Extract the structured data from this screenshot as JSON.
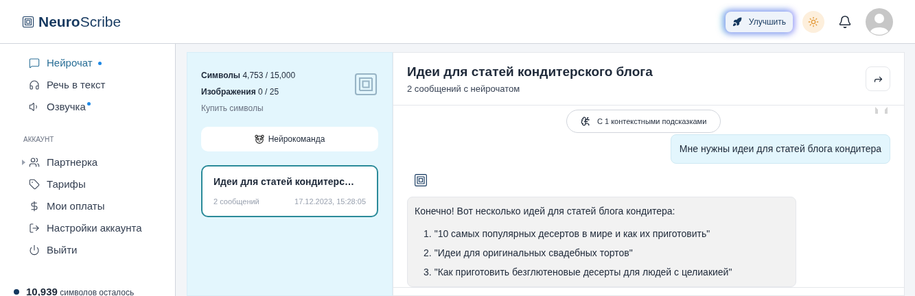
{
  "header": {
    "logo_bold": "Neuro",
    "logo_light": "Scribe",
    "upgrade_button": "Улучшить"
  },
  "sidebar": {
    "items": [
      {
        "label": "Нейрочат",
        "selected": true,
        "dot": true
      },
      {
        "label": "Речь в текст",
        "selected": false,
        "dot": false
      },
      {
        "label": "Озвучка",
        "selected": false,
        "dot": true
      }
    ],
    "section_title": "АККАУНТ",
    "account_items": [
      {
        "label": "Партнерка",
        "selected": false,
        "expanded": false
      },
      {
        "label": "Тарифы",
        "selected": false
      },
      {
        "label": "Мои оплаты",
        "selected": false
      },
      {
        "label": "Настройки аккаунта",
        "selected": false
      },
      {
        "label": "Выйти",
        "selected": false
      }
    ],
    "balance": {
      "value": "10,939",
      "label": "символов осталось"
    }
  },
  "usage": {
    "symbols_label": "Символы",
    "symbols": "4,753 / 15,000",
    "images_label": "Изображения",
    "images": "0 / 25",
    "buy_link": "Купить символы"
  },
  "team_button": "Нейрокоманда",
  "chats": [
    {
      "title": "Идеи для статей кондитерс…",
      "count": "2 сообщений",
      "date": "17.12.2023, 15:28:05",
      "selected": true
    }
  ],
  "chat": {
    "title": "Идеи для статей кондитерского блога",
    "subtitle": "2 сообщений с нейрочатом",
    "context_pill": "С 1 контекстными подсказками",
    "user_message": "Мне нужны идеи для статей блога кондитера",
    "reply_intro": "Конечно! Вот несколько идей для статей блога кондитера:",
    "reply_items": [
      {
        "number": "1.",
        "text": "\"10 самых популярных десертов в мире и как их приготовить\""
      },
      {
        "number": "2.",
        "text": "\"Идеи для оригинальных свадебных тортов\""
      },
      {
        "number": "3.",
        "text": "\"Как приготовить безглютеновые десерты для людей с целиакией\""
      }
    ]
  }
}
